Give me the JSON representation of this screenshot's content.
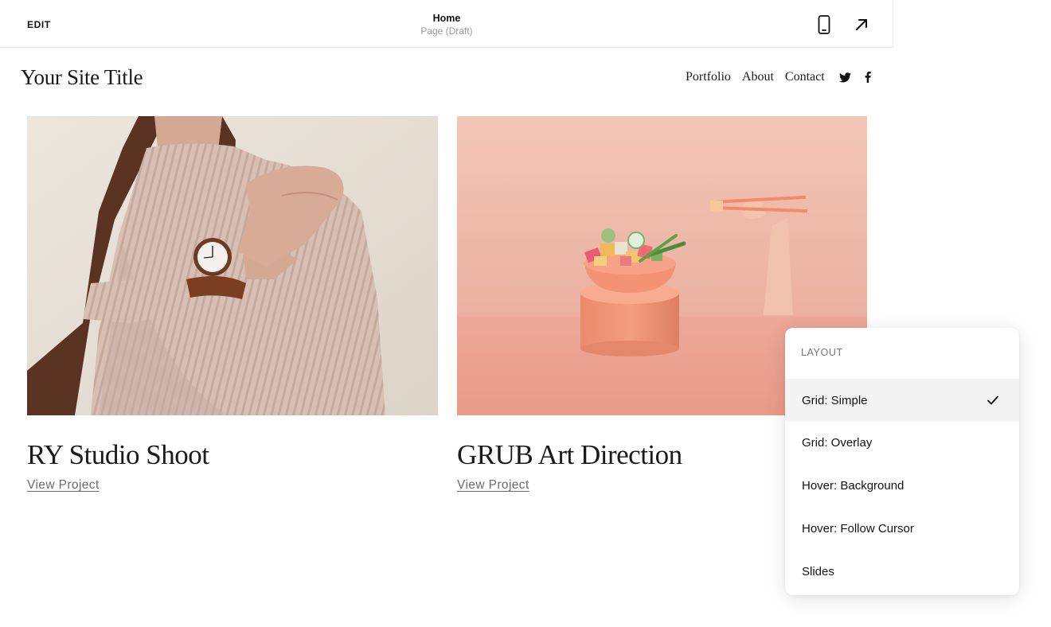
{
  "editor": {
    "edit_label": "EDIT",
    "page_title": "Home",
    "page_status": "Page (Draft)",
    "icons": [
      "mobile-preview-icon",
      "open-external-icon"
    ]
  },
  "site": {
    "title": "Your Site Title",
    "nav": [
      "Portfolio",
      "About",
      "Contact"
    ],
    "social": [
      "twitter-icon",
      "facebook-icon"
    ]
  },
  "projects": [
    {
      "title": "RY Studio Shoot",
      "link": "View Project"
    },
    {
      "title": "GRUB Art Direction",
      "link": "View Project"
    }
  ],
  "layout_menu": {
    "heading": "LAYOUT",
    "options": [
      "Grid: Simple",
      "Grid: Overlay",
      "Hover: Background",
      "Hover: Follow Cursor",
      "Slides"
    ],
    "selected": "Grid: Simple"
  },
  "colors": {
    "accent": "#111111",
    "muted": "#9a9a9a",
    "selected_bg": "#f3f3f3"
  }
}
